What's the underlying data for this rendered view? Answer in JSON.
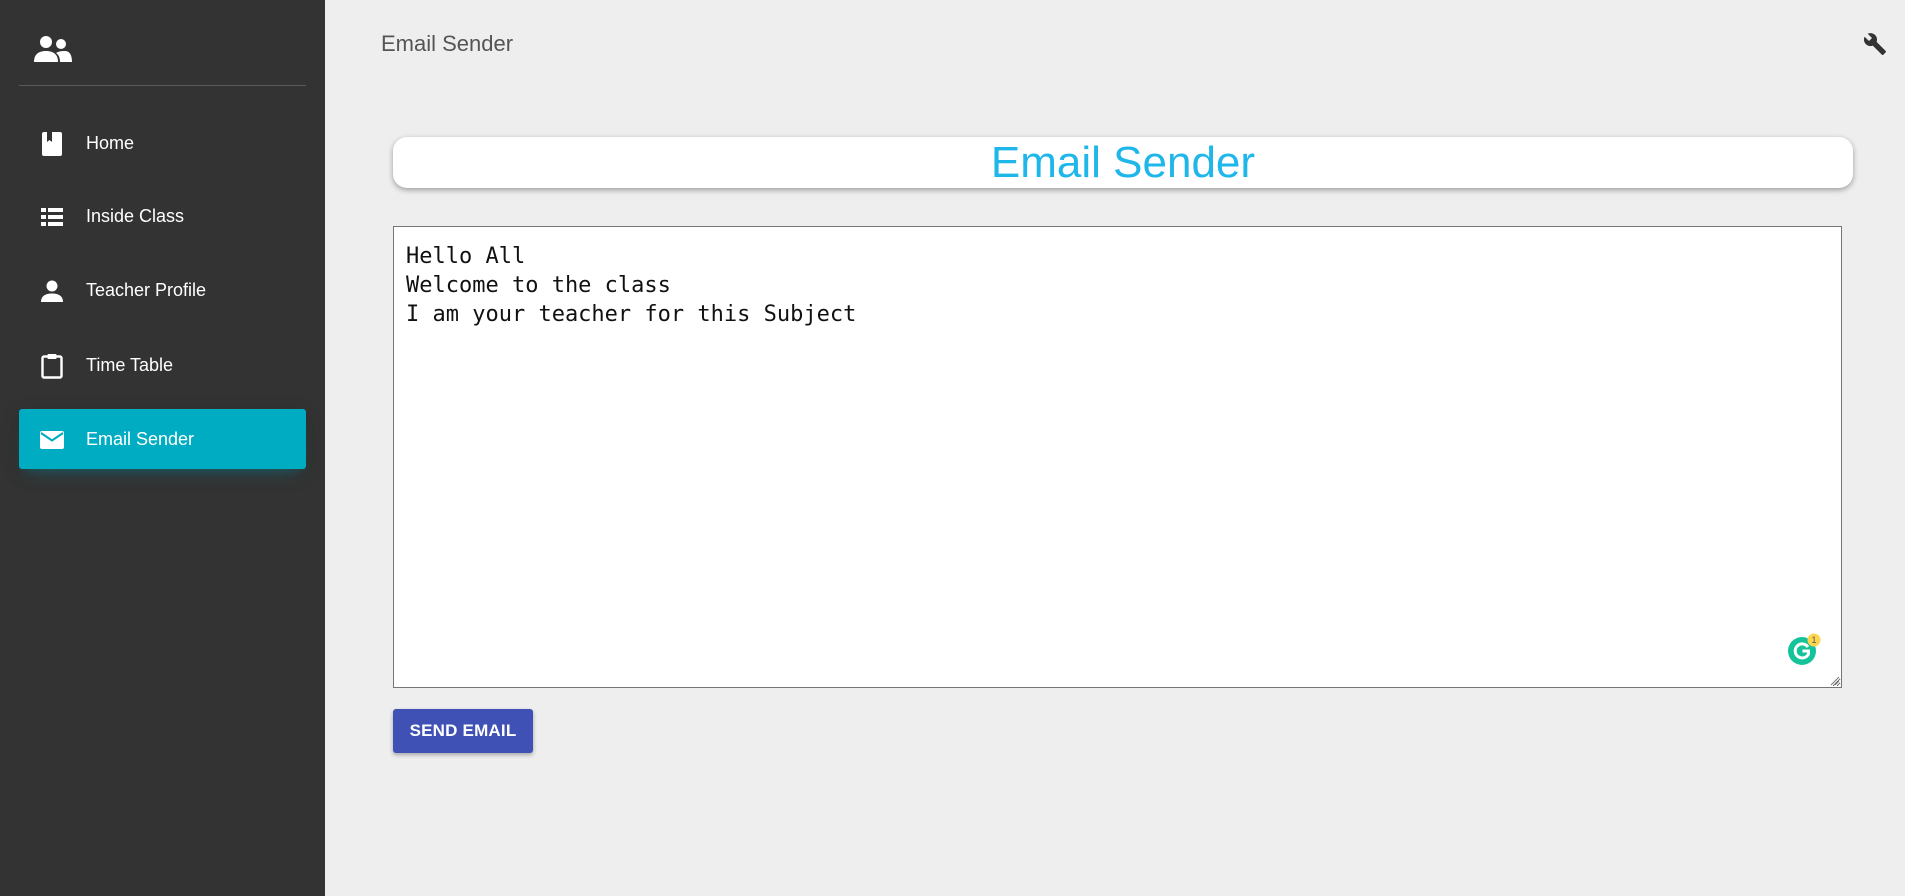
{
  "sidebar": {
    "logo_icon": "people-icon",
    "items": [
      {
        "label": "Home",
        "icon": "book-icon",
        "active": false
      },
      {
        "label": "Inside Class",
        "icon": "list-icon",
        "active": false
      },
      {
        "label": "Teacher Profile",
        "icon": "person-icon",
        "active": false
      },
      {
        "label": "Time Table",
        "icon": "clipboard-icon",
        "active": false
      },
      {
        "label": "Email Sender",
        "icon": "mail-icon",
        "active": true
      }
    ]
  },
  "topbar": {
    "title": "Email Sender",
    "settings_icon": "wrench-icon"
  },
  "main": {
    "header_title": "Email Sender",
    "message_lines": [
      "Hello All",
      "Welcome to the class",
      "I am your teacher for this Subject"
    ],
    "grammarly_badge": "1",
    "send_button_label": "SEND EMAIL"
  },
  "colors": {
    "sidebar_bg": "#333333",
    "active_item": "#00acc1",
    "header_title": "#1fb6ea",
    "send_button": "#3f51b5",
    "page_bg": "#eeeeee"
  }
}
